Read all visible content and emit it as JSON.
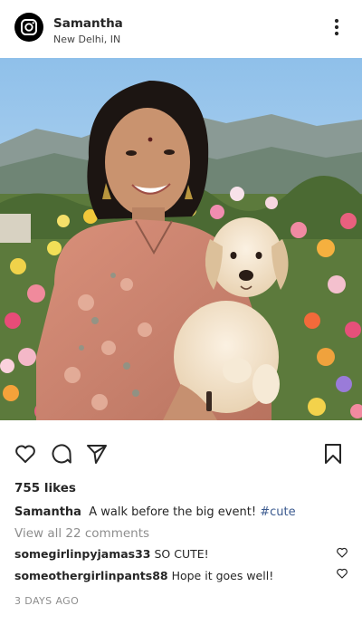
{
  "post": {
    "author": {
      "username": "Samantha",
      "location": "New Delhi, IN",
      "avatar_icon": "instagram-logo-icon"
    },
    "menu_icon": "more-vertical-icon",
    "image_alt": "Woman in floral kurta holding a golden retriever puppy in a flower field with mountains",
    "actions": {
      "like_icon": "heart-outline-icon",
      "comment_icon": "comment-icon",
      "share_icon": "send-icon",
      "save_icon": "bookmark-icon"
    },
    "likes_text": "755 likes",
    "caption": {
      "username": "Samantha",
      "text": "A walk before the big event!",
      "hashtag": "#cute"
    },
    "view_comments": "View all 22 comments",
    "comments": [
      {
        "username": "somegirlinpyjamas33",
        "text": "SO CUTE!"
      },
      {
        "username": "someothergirlinpants88",
        "text": "Hope it goes well!"
      }
    ],
    "timestamp": "3 DAYS AGO"
  },
  "colors": {
    "text": "#262626",
    "muted": "#8e8e8e",
    "hashtag": "#3b5a8f"
  }
}
